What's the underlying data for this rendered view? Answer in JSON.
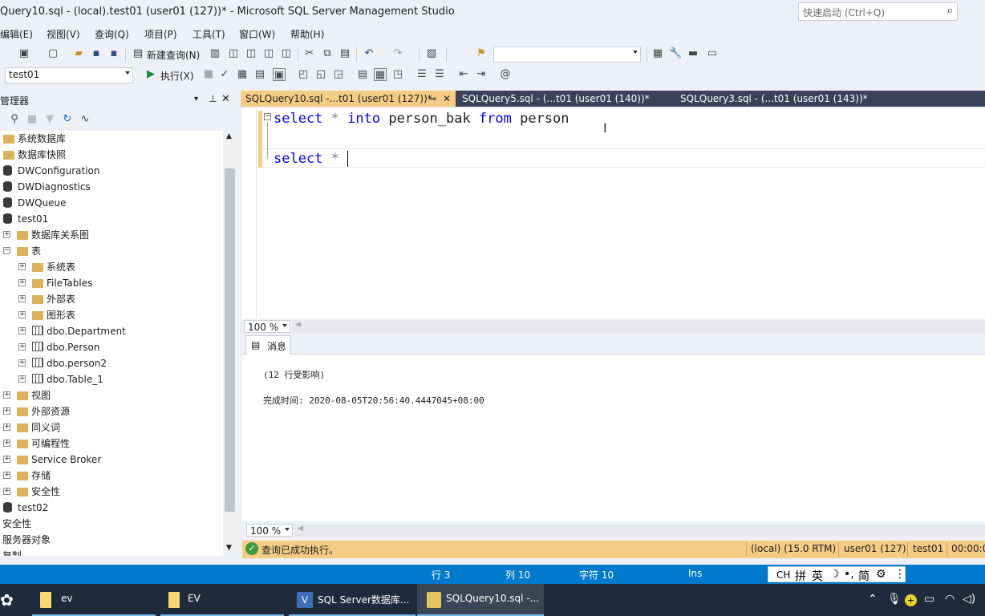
{
  "window": {
    "title": "Query10.sql - (local).test01 (user01 (127))* - Microsoft SQL Server Management Studio",
    "quick_launch_placeholder": "快速启动 (Ctrl+Q)"
  },
  "menu": [
    "编辑(E)",
    "视图(V)",
    "查询(Q)",
    "项目(P)",
    "工具(T)",
    "窗口(W)",
    "帮助(H)"
  ],
  "toolbar": {
    "new_query_label": "新建查询(N)",
    "database_select": "test01",
    "execute_label": "执行(X)",
    "combo_value": ""
  },
  "object_explorer": {
    "header": "管理器",
    "nodes": [
      {
        "label": "系统数据库",
        "icon": "folder-icon",
        "expander": ""
      },
      {
        "label": "数据库快照",
        "icon": "folder-icon",
        "expander": ""
      },
      {
        "label": "DWConfiguration",
        "icon": "database-icon",
        "expander": ""
      },
      {
        "label": "DWDiagnostics",
        "icon": "database-icon",
        "expander": ""
      },
      {
        "label": "DWQueue",
        "icon": "database-icon",
        "expander": ""
      },
      {
        "label": "test01",
        "icon": "database-icon",
        "expander": ""
      },
      {
        "label": "数据库关系图",
        "icon": "folder-icon",
        "expander": "+"
      },
      {
        "label": "表",
        "icon": "folder-icon",
        "expander": "−"
      },
      {
        "label": "系统表",
        "icon": "folder-icon",
        "expander": "+"
      },
      {
        "label": "FileTables",
        "icon": "folder-icon",
        "expander": "+"
      },
      {
        "label": "外部表",
        "icon": "folder-icon",
        "expander": "+"
      },
      {
        "label": "图形表",
        "icon": "folder-icon",
        "expander": "+"
      },
      {
        "label": "dbo.Department",
        "icon": "table-icon",
        "expander": "+"
      },
      {
        "label": "dbo.Person",
        "icon": "table-icon",
        "expander": "+"
      },
      {
        "label": "dbo.person2",
        "icon": "table-icon",
        "expander": "+"
      },
      {
        "label": "dbo.Table_1",
        "icon": "table-icon",
        "expander": "+"
      },
      {
        "label": "视图",
        "icon": "folder-icon",
        "expander": "+"
      },
      {
        "label": "外部资源",
        "icon": "folder-icon",
        "expander": "+"
      },
      {
        "label": "同义词",
        "icon": "folder-icon",
        "expander": "+"
      },
      {
        "label": "可编程性",
        "icon": "folder-icon",
        "expander": "+"
      },
      {
        "label": "Service Broker",
        "icon": "folder-icon",
        "expander": "+"
      },
      {
        "label": "存储",
        "icon": "folder-icon",
        "expander": "+"
      },
      {
        "label": "安全性",
        "icon": "folder-icon",
        "expander": "+"
      },
      {
        "label": "test02",
        "icon": "database-icon",
        "expander": ""
      },
      {
        "label": "安全性",
        "icon": "",
        "expander": ""
      },
      {
        "label": "服务器对象",
        "icon": "",
        "expander": ""
      },
      {
        "label": "复制",
        "icon": "",
        "expander": ""
      }
    ]
  },
  "tabs": [
    {
      "label": "SQLQuery10.sql -...t01 (user01 (127))*",
      "pin": "⊸",
      "close": "✕"
    },
    {
      "label": "SQLQuery5.sql - (...t01 (user01 (140))*"
    },
    {
      "label": "SQLQuery3.sql - (...t01 (user01 (143))*"
    }
  ],
  "editor": {
    "line1": {
      "kw1": "select",
      "op": " * ",
      "kw2": "into",
      "ident": " person_bak ",
      "kw3": "from",
      "ident2": " person"
    },
    "line3": {
      "kw1": "select",
      "op": " * "
    },
    "zoom": "100 %"
  },
  "results": {
    "tab_label": "消息",
    "rows_affected": "(12 行受影响)",
    "completion_time": "完成时间: 2020-08-05T20:56:40.4447045+08:00",
    "zoom": "100 %"
  },
  "query_status": {
    "message": "查询已成功执行。",
    "server": "(local) (15.0 RTM)",
    "user": "user01 (127)",
    "database": "test01",
    "elapsed": "00:00:0"
  },
  "app_status": {
    "line": "行 3",
    "col": "列 10",
    "char": "字符 10",
    "mode": "Ins"
  },
  "ime": [
    "CH",
    "拼",
    "英",
    "☽",
    "•,",
    "简",
    "⚙",
    "⋮"
  ],
  "taskbar": {
    "items": [
      "ev",
      "EV",
      "SQL Server数据库...",
      "SQLQuery10.sql -..."
    ]
  },
  "colors": {
    "status_blue": "#007acc",
    "tab_active": "#f5cc84",
    "tabstrip": "#3c4059",
    "keyword": "#0000ff"
  }
}
